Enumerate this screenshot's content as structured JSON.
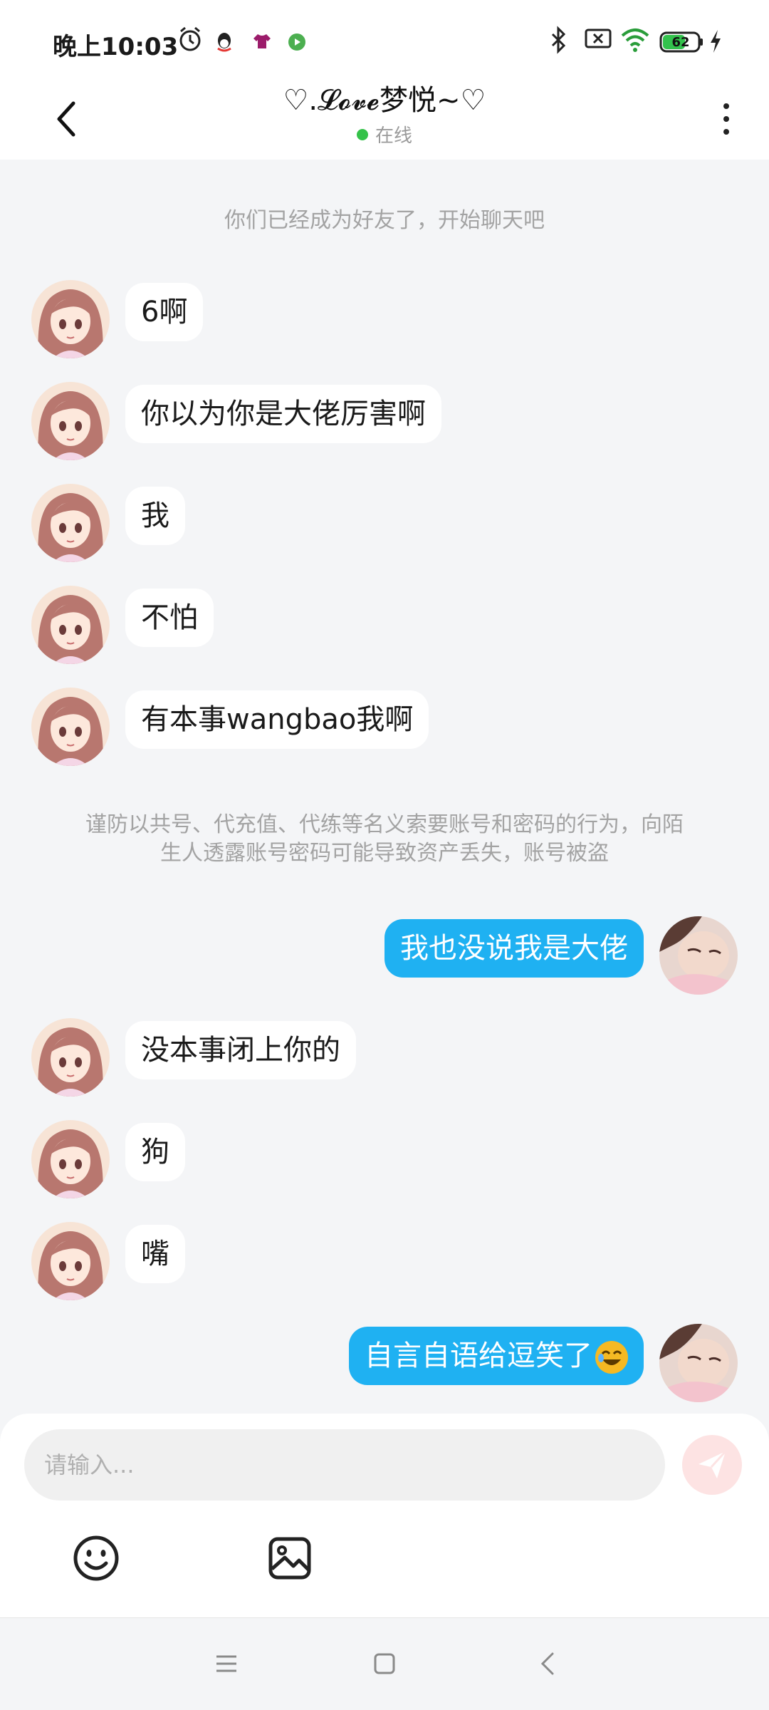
{
  "status_bar": {
    "time": "晚上10:03",
    "battery": "62"
  },
  "header": {
    "title": "♡.𝓛𝓸𝓿𝓮梦悦~♡",
    "status": "在线"
  },
  "notices": {
    "friend_added": "你们已经成为好友了，开始聊天吧",
    "warning_line1": "谨防以共号、代充值、代练等名义索要账号和密码的行为，向陌",
    "warning_line2": "生人透露账号密码可能导致资产丢失，账号被盗"
  },
  "messages": [
    {
      "side": "left",
      "text": "6啊"
    },
    {
      "side": "left",
      "text": "你以为你是大佬厉害啊"
    },
    {
      "side": "left",
      "text": "我"
    },
    {
      "side": "left",
      "text": "不怕"
    },
    {
      "side": "left",
      "text": "有本事wangbao我啊"
    },
    {
      "side": "right",
      "text": "我也没说我是大佬"
    },
    {
      "side": "left",
      "text": "没本事闭上你的"
    },
    {
      "side": "left",
      "text": "狗"
    },
    {
      "side": "left",
      "text": "嘴"
    },
    {
      "side": "right",
      "text": "自言自语给逗笑了",
      "emoji": "rofl-emoji"
    }
  ],
  "input": {
    "placeholder": "请输入..."
  },
  "colors": {
    "accent_blue": "#1fb1f2",
    "online_green": "#35c24a",
    "send_button_bg": "#fde3e3"
  },
  "icons": [
    "back-arrow-icon",
    "more-vertical-icon",
    "send-icon",
    "emoji-icon",
    "image-icon",
    "menu-icon",
    "home-icon",
    "nav-back-icon"
  ]
}
